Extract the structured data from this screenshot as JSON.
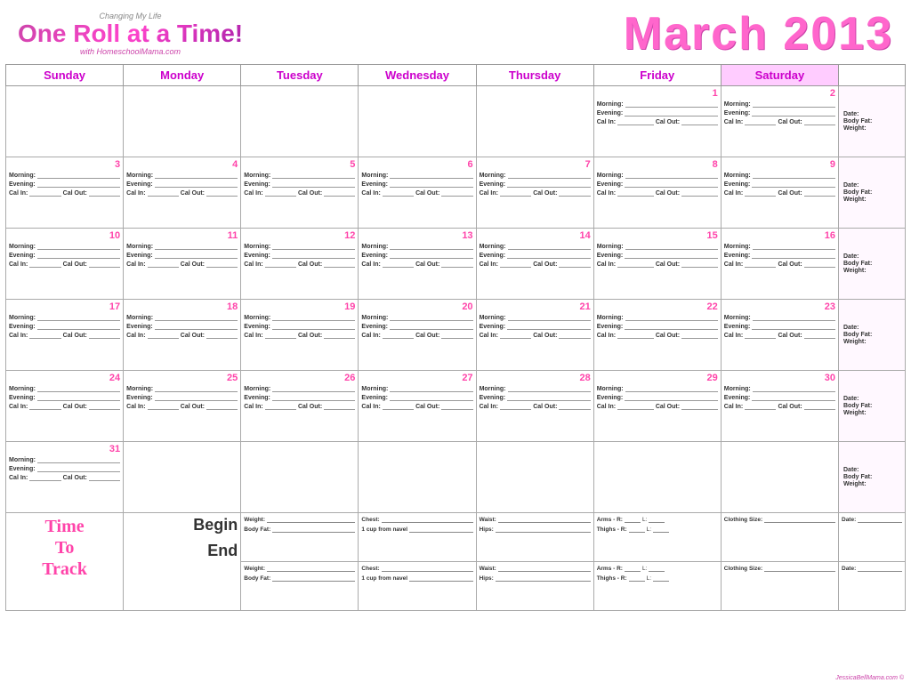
{
  "header": {
    "changing_my_life": "Changing My Life",
    "logo_title": "One Roll at a Time!",
    "logo_sub": "with HomeschoolMama.com",
    "month": "March 2013"
  },
  "days_of_week": [
    "Sunday",
    "Monday",
    "Tuesday",
    "Wednesday",
    "Thursday",
    "Friday",
    "Saturday"
  ],
  "week1": {
    "sun": null,
    "mon": null,
    "tue": null,
    "wed": null,
    "thu": null,
    "fri": {
      "num": "1"
    },
    "sat": {
      "num": "2"
    }
  },
  "week2": {
    "sun": {
      "num": "3"
    },
    "mon": {
      "num": "4"
    },
    "tue": {
      "num": "5"
    },
    "wed": {
      "num": "6"
    },
    "thu": {
      "num": "7"
    },
    "fri": {
      "num": "8"
    },
    "sat": {
      "num": "9"
    }
  },
  "week3": {
    "sun": {
      "num": "10"
    },
    "mon": {
      "num": "11"
    },
    "tue": {
      "num": "12"
    },
    "wed": {
      "num": "13"
    },
    "thu": {
      "num": "14"
    },
    "fri": {
      "num": "15"
    },
    "sat": {
      "num": "16"
    }
  },
  "week4": {
    "sun": {
      "num": "17"
    },
    "mon": {
      "num": "18"
    },
    "tue": {
      "num": "19"
    },
    "wed": {
      "num": "20"
    },
    "thu": {
      "num": "21"
    },
    "fri": {
      "num": "22"
    },
    "sat": {
      "num": "23"
    }
  },
  "week5": {
    "sun": {
      "num": "24"
    },
    "mon": {
      "num": "25"
    },
    "tue": {
      "num": "26"
    },
    "wed": {
      "num": "27"
    },
    "thu": {
      "num": "28"
    },
    "fri": {
      "num": "29"
    },
    "sat": {
      "num": "30"
    }
  },
  "week6": {
    "sun": {
      "num": "31"
    },
    "mon": null,
    "tue": null,
    "wed": null,
    "thu": null,
    "fri": null,
    "sat": null
  },
  "cell_labels": {
    "morning": "Morning:",
    "evening": "Evening:",
    "cal_in": "Cal In:",
    "cal_out": "Cal Out:"
  },
  "sidebar_weekly": {
    "date": "Date:",
    "body_fat": "Body Fat:",
    "weight": "Weight:"
  },
  "bottom": {
    "time_track": "Time\nTo\nTrack",
    "begin": "Begin",
    "end": "End",
    "measurements": {
      "weight": "Weight:",
      "body_fat": "Body Fat:",
      "chest": "Chest:",
      "cup_from_navel": "1 cup from navel",
      "waist": "Waist:",
      "hips": "Hips:",
      "arms": "Arms -",
      "thighs": "Thighs -",
      "right": "R:",
      "left": "L:",
      "clothing_size": "Clothing Size:",
      "date": "Date:"
    }
  },
  "footer": {
    "credit": "JessicaBellMama.com ©"
  }
}
